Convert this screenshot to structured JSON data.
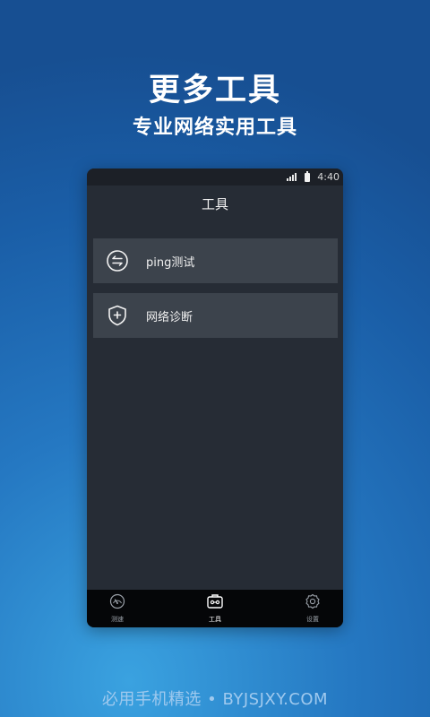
{
  "header": {
    "title": "更多工具",
    "subtitle": "专业网络实用工具"
  },
  "phone": {
    "status_bar": {
      "time": "4:40",
      "icons": [
        "signal-icon",
        "battery-icon"
      ]
    },
    "page_title": "工具",
    "tools": [
      {
        "label": "ping测试",
        "icon": "exchange-arrows-icon"
      },
      {
        "label": "网络诊断",
        "icon": "shield-plus-icon"
      }
    ],
    "nav": [
      {
        "label": "测速",
        "icon": "speedometer-icon",
        "active": false
      },
      {
        "label": "工具",
        "icon": "toolbox-icon",
        "active": true
      },
      {
        "label": "设置",
        "icon": "gear-icon",
        "active": false
      }
    ]
  },
  "footer": {
    "watermark": "必用手机精选 • BYJSJXY.COM"
  },
  "colors": {
    "phone_bg": "#262c35",
    "item_bg": "#3c434c",
    "nav_bg": "#050608",
    "status_bg": "#1c2027"
  }
}
